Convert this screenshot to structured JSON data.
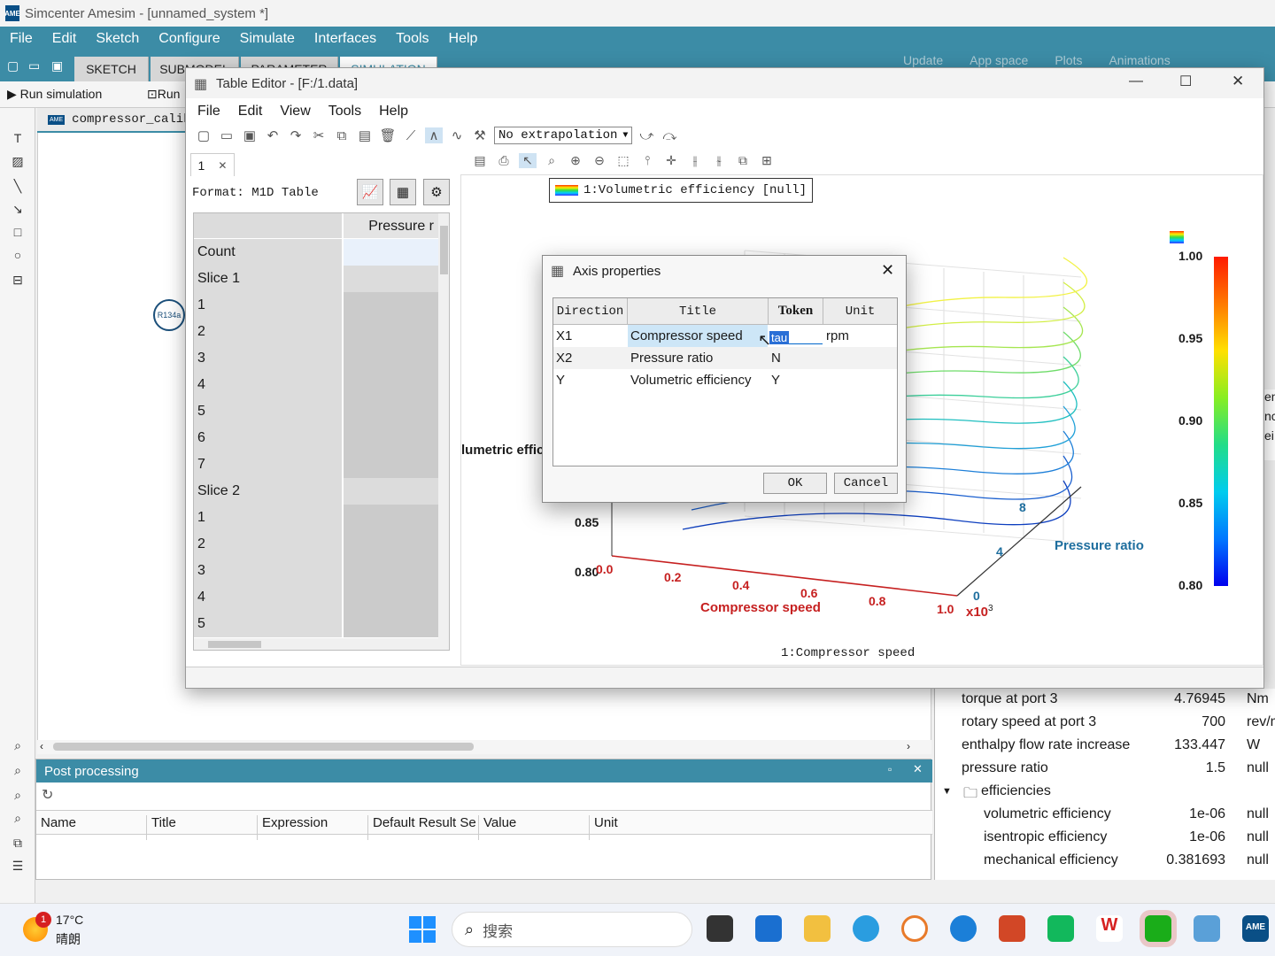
{
  "app": {
    "title": "Simcenter Amesim - [unnamed_system *]",
    "logo": "AME",
    "menu": [
      "File",
      "Edit",
      "Sketch",
      "Configure",
      "Simulate",
      "Interfaces",
      "Tools",
      "Help"
    ],
    "mode_tabs": [
      "SKETCH",
      "SUBMODEL",
      "PARAMETER",
      "SIMULATION"
    ],
    "toolbar_right": [
      "Update",
      "App space",
      "Plots",
      "Animations"
    ],
    "run_simulation": "Run simulation",
    "run_short": "Run",
    "doc_tab": "compressor_calib",
    "component_label": "R134a"
  },
  "post": {
    "title": "Post processing",
    "columns": [
      "Name",
      "Title",
      "Expression",
      "Default Result Se",
      "Value",
      "Unit"
    ]
  },
  "right_panel": {
    "rows": [
      {
        "name": "torque at port 3",
        "value": "4.76945",
        "unit": "Nm"
      },
      {
        "name": "rotary speed at port 3",
        "value": "700",
        "unit": "rev/mi"
      },
      {
        "name": "enthalpy flow rate increase",
        "value": "133.447",
        "unit": "W"
      },
      {
        "name": "pressure ratio",
        "value": "1.5",
        "unit": "null"
      }
    ],
    "group": "efficiencies",
    "group_rows": [
      {
        "name": "volumetric efficiency",
        "value": "1e-06",
        "unit": "null"
      },
      {
        "name": "isentropic efficiency",
        "value": "1e-06",
        "unit": "null"
      },
      {
        "name": "mechanical efficiency",
        "value": "0.381693",
        "unit": "null"
      }
    ],
    "clipped_labels": [
      "en",
      "nc",
      "ei"
    ]
  },
  "table_editor": {
    "title": "Table Editor - [F:/1.data]",
    "menu": [
      "File",
      "Edit",
      "View",
      "Tools",
      "Help"
    ],
    "extrapolation": "No extrapolation",
    "tab": "1",
    "format": "Format: M1D Table",
    "column_header": "Pressure r",
    "rows": [
      "Count",
      "Slice 1",
      "1",
      "2",
      "3",
      "4",
      "5",
      "6",
      "7",
      "Slice 2",
      "1",
      "2",
      "3",
      "4",
      "5"
    ]
  },
  "plot": {
    "legend": "1:Volumetric efficiency [null]",
    "xlabel": "Compressor speed",
    "x_scale_note": "x10",
    "x_exp": "3",
    "ylabel": "Pressure ratio",
    "zlabel_clipped": "lumetric effic",
    "x_ticks": [
      "0.0",
      "0.2",
      "0.4",
      "0.6",
      "0.8",
      "1.0"
    ],
    "y_ticks": [
      "0",
      "4",
      "8"
    ],
    "z_ticks": [
      "0.80",
      "0.85"
    ],
    "colorbar_ticks": [
      "1.00",
      "0.95",
      "0.90",
      "0.85",
      "0.80"
    ],
    "footer": "1:Compressor speed"
  },
  "chart_data": {
    "type": "surface",
    "xlabel": "Compressor speed",
    "ylabel": "Pressure ratio",
    "zlabel": "Volumetric efficiency",
    "xlim": [
      0.0,
      1.0
    ],
    "ylim": [
      0,
      8
    ],
    "zlim": [
      0.8,
      1.0
    ],
    "colorbar": [
      0.8,
      1.0
    ]
  },
  "dialog": {
    "title": "Axis properties",
    "columns": [
      "Direction",
      "Title",
      "Token",
      "Unit"
    ],
    "rows": [
      {
        "direction": "X1",
        "title": "Compressor speed",
        "token": "tau",
        "unit": "rpm"
      },
      {
        "direction": "X2",
        "title": "Pressure ratio",
        "token": "N",
        "unit": ""
      },
      {
        "direction": "Y",
        "title": "Volumetric efficiency",
        "token": "Y",
        "unit": ""
      }
    ],
    "ok": "OK",
    "cancel": "Cancel"
  },
  "taskbar": {
    "weather_badge": "1",
    "temperature": "17°C",
    "condition": "晴朗",
    "search_placeholder": "搜索"
  }
}
